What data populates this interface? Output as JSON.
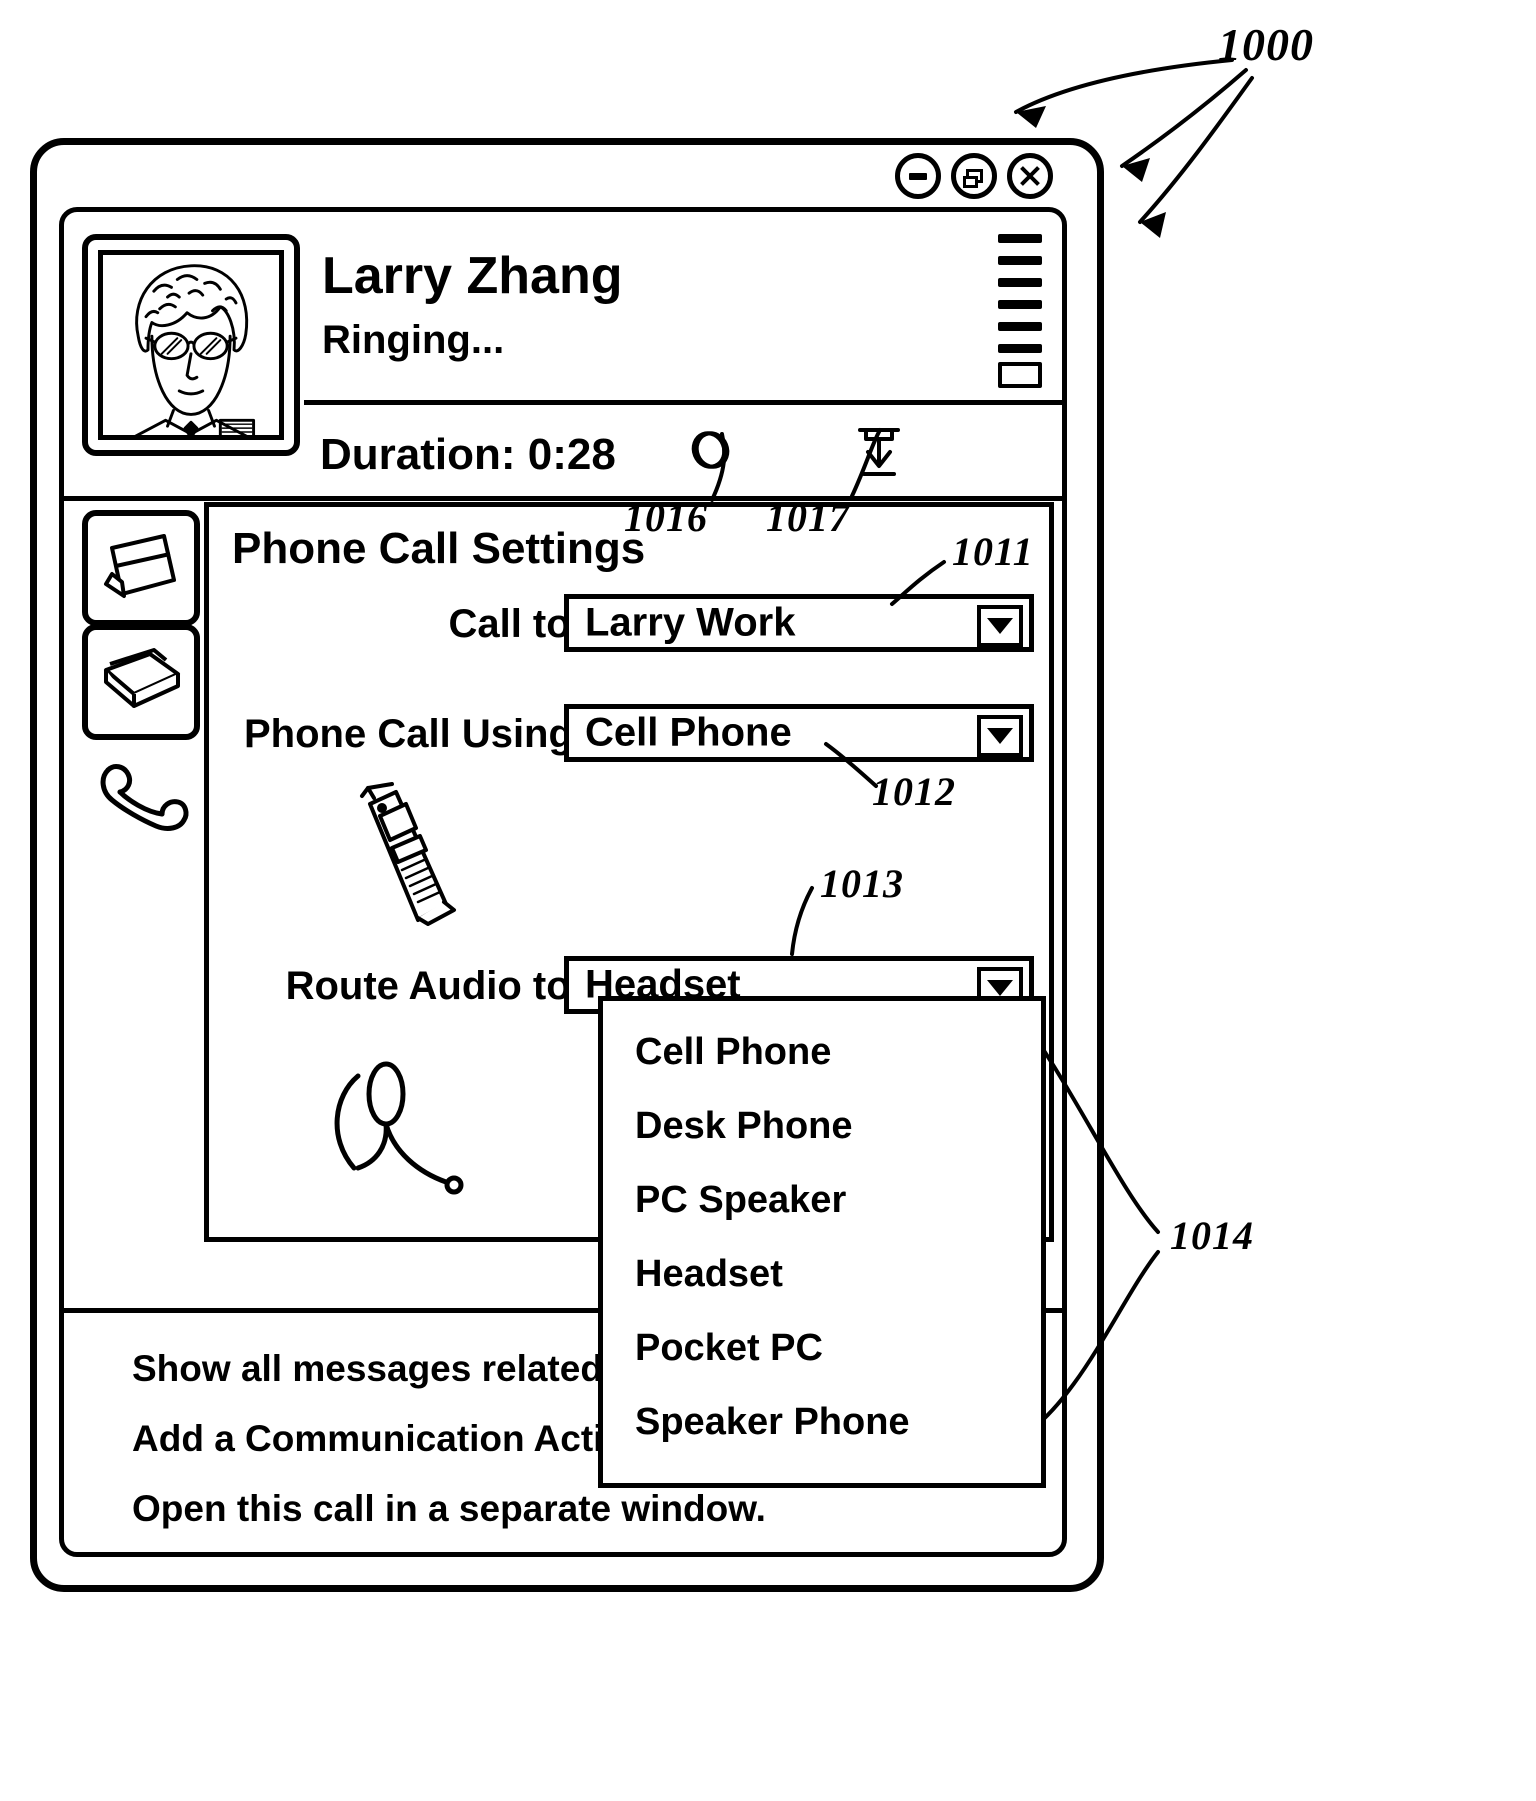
{
  "figure": {
    "main_ref": "1000",
    "callouts": [
      {
        "id": "1011",
        "target": "call-to-combo"
      },
      {
        "id": "1012",
        "target": "phone-call-using-combo"
      },
      {
        "id": "1013",
        "target": "route-audio-combo"
      },
      {
        "id": "1014",
        "target": "audio-dropdown-list"
      },
      {
        "id": "1016",
        "target": "hold-button"
      },
      {
        "id": "1017",
        "target": "hang-up-button"
      }
    ]
  },
  "window": {
    "buttons": {
      "minimize": "minimize-button",
      "restore": "restore-button",
      "close": "close-button"
    }
  },
  "header": {
    "contact_name": "Larry Zhang",
    "call_status": "Ringing...",
    "avatar_alt": "contact-portrait"
  },
  "callbar": {
    "duration_label": "Duration: 0:28",
    "hold_label": "Hold",
    "hang_up_label": "Hang Up"
  },
  "tabs": [
    {
      "name": "tab-card",
      "icon": "card-stand-icon"
    },
    {
      "name": "tab-address-book",
      "icon": "book-icon"
    },
    {
      "name": "tab-phone",
      "icon": "handset-icon"
    }
  ],
  "settings": {
    "title": "Phone Call Settings",
    "fields": [
      {
        "name": "call-to",
        "label": "Call to:",
        "value": "Larry Work",
        "ref": "1011"
      },
      {
        "name": "phone-call-using",
        "label": "Phone Call Using:",
        "value": "Cell Phone",
        "ref": "1012"
      },
      {
        "name": "route-audio-to",
        "label": "Route Audio to:",
        "value": "Headset",
        "ref": "1013"
      }
    ],
    "device_illustration": "cell-phone-icon",
    "audio_illustration": "headset-icon"
  },
  "audio_dropdown": {
    "ref": "1014",
    "options": [
      "Cell Phone",
      "Desk Phone",
      "PC Speaker",
      "Headset",
      "Pocket PC",
      "Speaker Phone"
    ]
  },
  "links": [
    {
      "name": "show-all-messages-link",
      "text": "Show all messages related to Larry Zhang"
    },
    {
      "name": "add-communication-activity-link",
      "text": "Add a Communication Activity",
      "has_caret": true
    },
    {
      "name": "open-call-separate-window-link",
      "text": "Open this call in a separate window."
    }
  ]
}
